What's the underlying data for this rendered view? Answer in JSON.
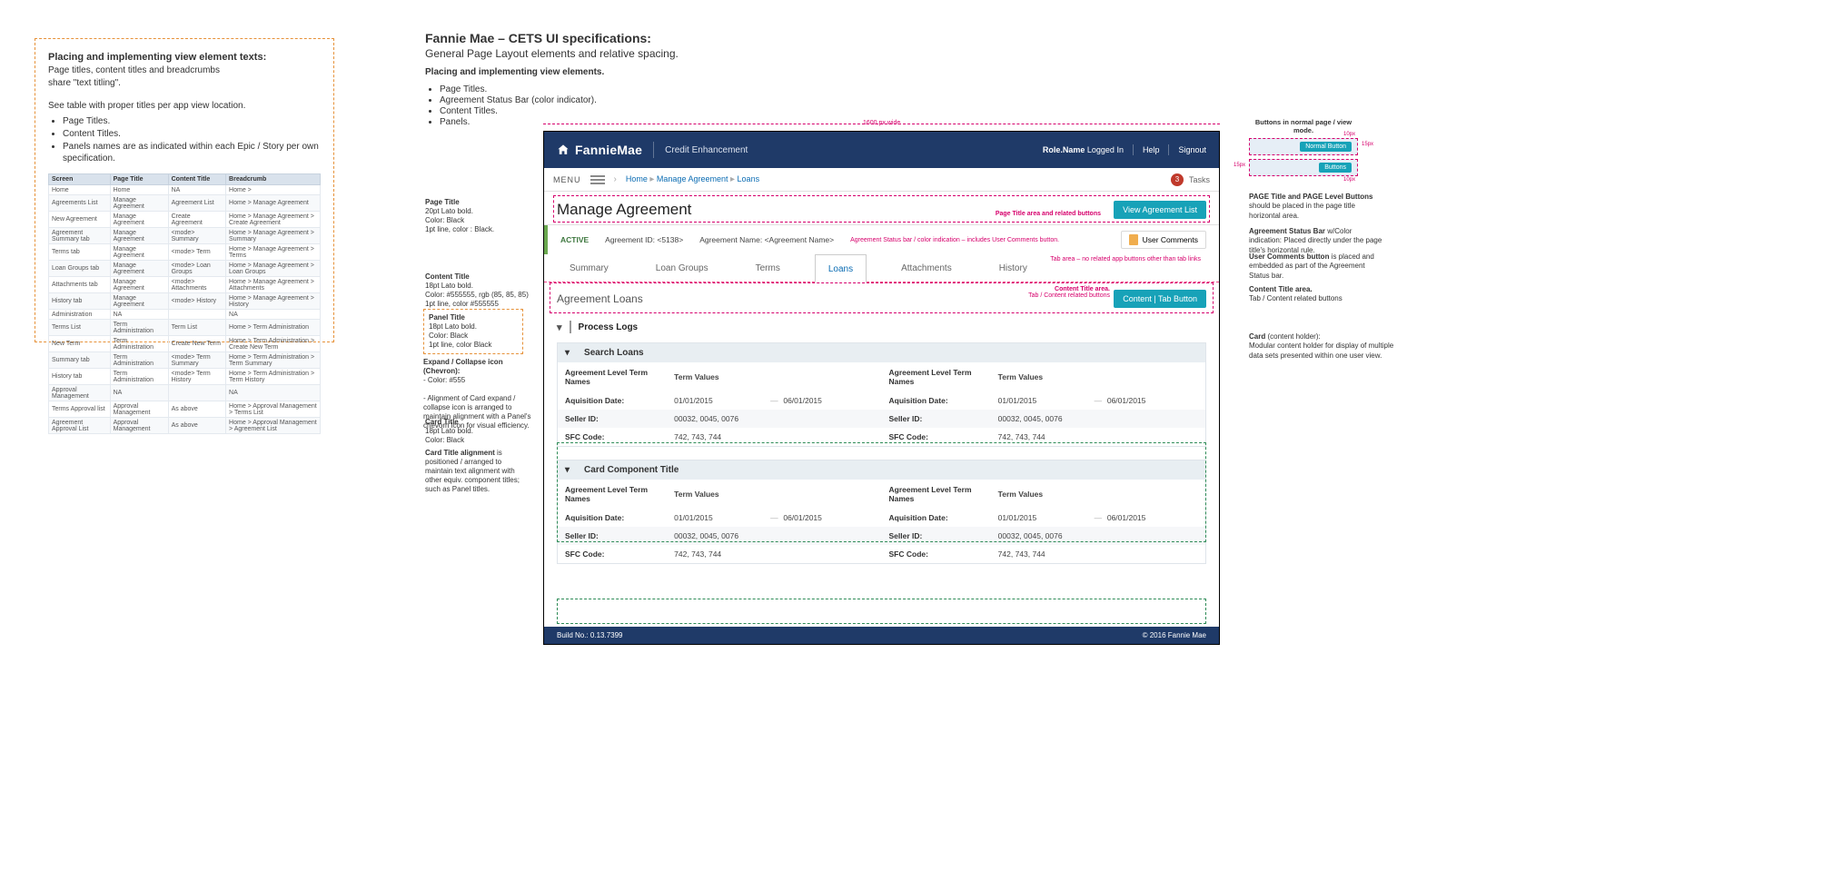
{
  "doc": {
    "title": "Fannie Mae – CETS UI specifications:",
    "subtitle": "General Page Layout elements and relative spacing.",
    "elements_head": "Placing and implementing view elements.",
    "elements_items": [
      "Page Titles.",
      "Agreement Status Bar (color indicator).",
      "Content Titles.",
      "Panels."
    ]
  },
  "left": {
    "h": "Placing and implementing view element texts:",
    "sub1": "Page titles, content titles and breadcrumbs",
    "sub2": "share \"text titling\".",
    "para": "See table with proper titles per app view location.",
    "bullets": [
      "Page Titles.",
      "Content Titles.",
      "Panels names are as indicated within each Epic / Story per own specification."
    ]
  },
  "titles_table": {
    "head": [
      "Screen",
      "Page Title",
      "Content Title",
      "Breadcrumb"
    ],
    "rows": [
      [
        "Home",
        "Home",
        "NA",
        "Home >"
      ],
      [
        "Agreements List",
        "Manage Agreement",
        "Agreement List",
        "Home > Manage Agreement"
      ],
      [
        "New Agreement",
        "Manage Agreement",
        "Create Agreement",
        "Home > Manage Agreement > Create Agreement"
      ],
      [
        "Agreement Summary tab",
        "Manage Agreement",
        "<mode> Summary",
        "Home > Manage Agreement > Summary"
      ],
      [
        "Terms tab",
        "Manage Agreement",
        "<mode> Term",
        "Home > Manage Agreement > Terms"
      ],
      [
        "Loan Groups tab",
        "Manage Agreement",
        "<mode> Loan Groups",
        "Home > Manage Agreement > Loan Groups"
      ],
      [
        "Attachments tab",
        "Manage Agreement",
        "<mode> Attachments",
        "Home > Manage Agreement > Attachments"
      ],
      [
        "History tab",
        "Manage Agreement",
        "<mode> History",
        "Home > Manage Agreement > History"
      ],
      [
        "Administration",
        "NA",
        "",
        "NA"
      ],
      [
        "Terms List",
        "Term Administration",
        "Term List",
        "Home > Term Administration"
      ],
      [
        "New Term",
        "Term Administration",
        "Create New Term",
        "Home > Term Administration > Create New Term"
      ],
      [
        "Summary tab",
        "Term Administration",
        "<mode> Term Summary",
        "Home > Term Administration > Term Summary"
      ],
      [
        "History tab",
        "Term Administration",
        "<mode> Term History",
        "Home > Term Administration > Term History"
      ],
      [
        "Approval Management",
        "NA",
        "",
        "NA"
      ],
      [
        "Terms Approval list",
        "Approval Management",
        "As above",
        "Home > Approval Management > Terms List"
      ],
      [
        "Agreement Approval List",
        "Approval Management",
        "As above",
        "Home > Approval Management > Agreement List"
      ]
    ]
  },
  "notes": {
    "page_title": {
      "t": "Page Title",
      "l1": "20pt Lato bold.",
      "l2": "Color: Black",
      "l3": "1pt line, color : Black."
    },
    "content_title": {
      "t": "Content Title",
      "l1": "18pt Lato bold.",
      "l2": "Color: #555555, rgb (85, 85, 85)",
      "l3": "1pt line, color #555555"
    },
    "panel_title": {
      "t": "Panel Title",
      "l1": "18pt Lato bold.",
      "l2": "Color: Black",
      "l3": "1pt line, color Black"
    },
    "expand": {
      "t": "Expand / Collapse icon (Chevron):",
      "l1": "- Color: #555",
      "l2": "- Alignment of Card expand / collapse icon is arranged to maintain alignment with a Panel's chevorn icon for visual efficiency."
    },
    "card_title": {
      "t": "Card Title",
      "l1": "18pt Lato bold.",
      "l2": "Color: Black"
    },
    "card_align": {
      "t": "Card Title alignment",
      "txt": " is positioned / arranged to maintain text alignment with other equiv. component titles; such as Panel titles."
    }
  },
  "rnotes": {
    "btn_modes": "Buttons in normal page / view  mode.",
    "btn_normal": "Normal Button",
    "btn_small": "Buttons",
    "px10": "10px",
    "px15": "15px",
    "page_btns": {
      "t": "PAGE Title and PAGE Level Buttons ",
      "txt": "should be placed in the page title horizontal area."
    },
    "status": {
      "t": "Agreement Status Bar ",
      "txt": "w/Color indication: Placed directly under the page title's horizontal rule."
    },
    "ucomments": {
      "t": "User Comments button ",
      "txt": "is placed and embedded as part of the Agreement Status bar."
    },
    "content_area": {
      "t": "Content Title area.",
      "txt": "Tab / Content related buttons"
    },
    "card_holder": {
      "t": "Card ",
      "t2": "(content holder):",
      "txt": "Modular content holder for display of multiple data sets presented within one user view."
    }
  },
  "app": {
    "logo_name": "FannieMae",
    "logo_sub": "Credit Enhancement",
    "role": "Role.Name",
    "logged": "Logged In",
    "help": "Help",
    "signout": "Signout",
    "menu": "MENU",
    "crumb": {
      "home": "Home",
      "ma": "Manage Agreement",
      "loans": "Loans"
    },
    "tasks": "Tasks",
    "tasks_badge": "3",
    "page_title": "Manage Agreement",
    "pt_note": "Page Title area and related buttons",
    "btn_view": "View Agreement List",
    "status": {
      "active": "ACTIVE",
      "aid_lbl": "Agreement ID:",
      "aid": "<5138>",
      "aname_lbl": "Agreement  Name:",
      "aname": "<Agreement Name>",
      "note": "Agreement Status bar / color indication – includes User Comments button.",
      "uc": "User Comments"
    },
    "tabs": {
      "summary": "Summary",
      "loan_groups": "Loan Groups",
      "terms": "Terms",
      "loans": "Loans",
      "attachments": "Attachments",
      "history": "History",
      "note": "Tab area – no related app buttons other than tab links"
    },
    "content_title": "Agreement Loans",
    "ct_note1": "Content Title area.",
    "ct_note2": "Tab / Content related buttons",
    "ct_btn": "Content | Tab Button",
    "panel_process": "Process Logs",
    "card1_title": "Search Loans",
    "card2_title": "Card Component Title",
    "cols": {
      "altn": "Agreement Level Term  Names",
      "tv": "Term Values"
    },
    "rows": {
      "aq": {
        "lbl": "Aquisition Date:",
        "v1": "01/01/2015",
        "v2": "06/01/2015"
      },
      "seller": {
        "lbl": "Seller ID:",
        "v": "00032, 0045, 0076"
      },
      "sfc": {
        "lbl": "SFC Code:",
        "v": "742, 743, 744"
      }
    },
    "build": "Build No.: 0.13.7399",
    "copy": "© 2016 Fannie Mae"
  },
  "width_label": "1600 px wide"
}
